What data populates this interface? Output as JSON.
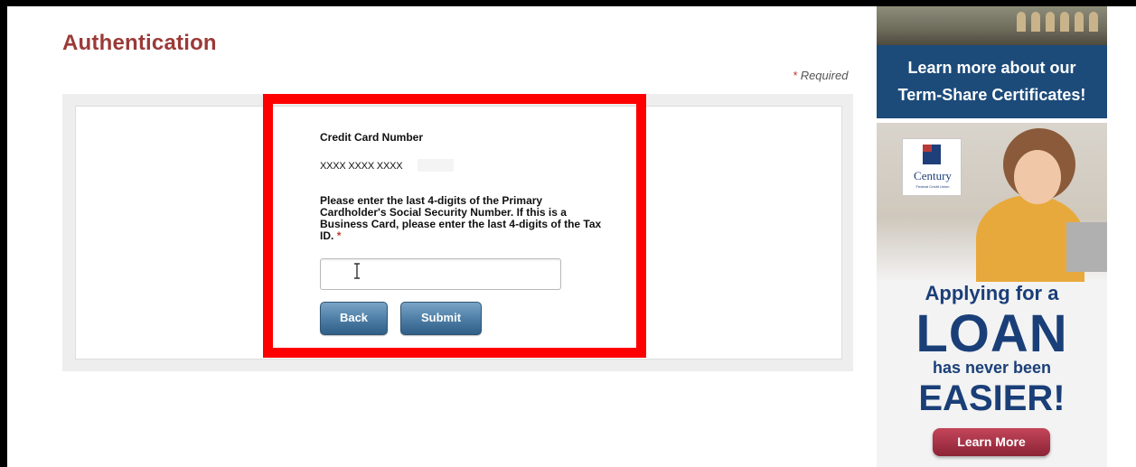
{
  "page": {
    "title": "Authentication",
    "required_star": "*",
    "required_label": "Required"
  },
  "form": {
    "cc_label": "Credit Card Number",
    "cc_masked_value": "XXXX XXXX XXXX",
    "ssn_prompt": "Please enter the last 4-digits of the Primary Cardholder's Social Security Number. If this is a Business Card, please enter the last 4-digits of the Tax ID.",
    "ssn_required_star": "*",
    "ssn_input_value": "",
    "back_label": "Back",
    "submit_label": "Submit"
  },
  "ads": {
    "top": {
      "line1": "Learn more about our",
      "line2": "Term-Share Certificates!"
    },
    "bottom": {
      "logo_brand": "Century",
      "logo_sub": "Federal Credit Union",
      "headline_1": "Applying for a",
      "headline_2": "LOAN",
      "headline_3": "has never been",
      "headline_4": "EASIER!",
      "button_label": "Learn More"
    }
  },
  "colors": {
    "title": "#9b3a38",
    "highlight": "#ff0000",
    "button": "#4f7fa7",
    "ad_navy": "#1a3f78",
    "ad_button": "#a8344a"
  }
}
